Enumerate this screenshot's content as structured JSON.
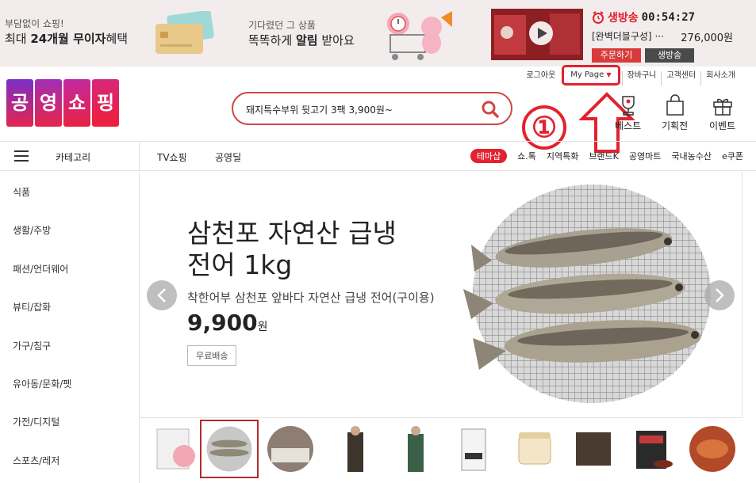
{
  "promo": {
    "left_line1": "부담없이 쇼핑!",
    "left_line2_pre": "최대 ",
    "left_line2_bold": "24개월 무이자",
    "left_line2_post": "혜택",
    "mid_line1": "기다렸던 그 상품",
    "mid_line2_pre": "똑똑하게 ",
    "mid_line2_bold": "알림",
    "mid_line2_post": " 받아요"
  },
  "live": {
    "label": "생방송",
    "time": "00:54:27",
    "product": "[완벽더블구성]",
    "ellipsis": "···",
    "price": "276,000원",
    "order_button": "주문하기",
    "live_button": "생방송"
  },
  "util_links": {
    "logout": "로그아웃",
    "mypage": "My Page",
    "cart": "장바구니",
    "support": "고객센터",
    "about": "회사소개"
  },
  "logo": {
    "chars": [
      "공",
      "영",
      "쇼",
      "핑"
    ]
  },
  "search": {
    "value": "돼지특수부위 뒷고기 3팩 3,900원~"
  },
  "annotation": {
    "number": "①"
  },
  "quick_links": {
    "best": "베스트",
    "plan": "기획전",
    "event": "이벤트"
  },
  "nav": {
    "category": "카테고리",
    "tv_shopping": "TV쇼핑",
    "gongyeong_deal": "공영딜",
    "theme_shop": "테마샵",
    "right_links": [
      "쇼.톡",
      "지역특화",
      "브랜드K",
      "공영마트",
      "국내농수산",
      "e쿠폰"
    ]
  },
  "categories": [
    "식품",
    "생활/주방",
    "패션/언더웨어",
    "뷰티/잡화",
    "가구/침구",
    "유아동/문화/펫",
    "가전/디지털",
    "스포츠/레저"
  ],
  "hero": {
    "title_line1": "삼천포 자연산 급냉",
    "title_line2": "전어 1kg",
    "subtitle": "착한어부 삼천포 앞바다 자연산 급냉 전어(구이용)",
    "price": "9,900",
    "price_unit": "원",
    "tag": "무료배송"
  },
  "colors": {
    "accent": "#e4212f",
    "promo_bg": "#f2ecec",
    "thumb_selected": "#b32a2a"
  }
}
